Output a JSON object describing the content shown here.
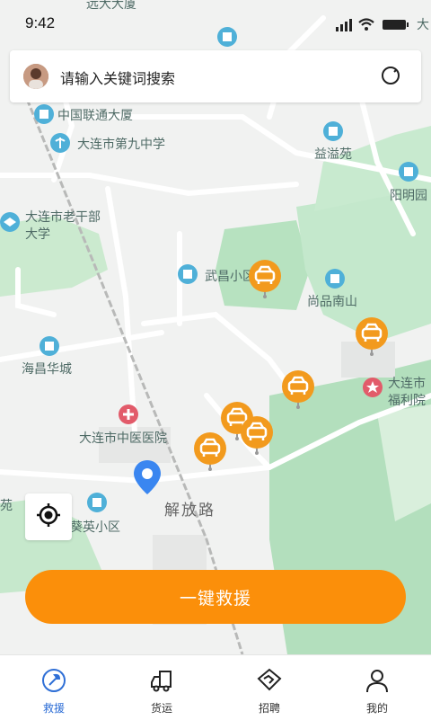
{
  "status_bar": {
    "time": "9:42"
  },
  "search": {
    "placeholder": "请输入关键词搜索"
  },
  "map": {
    "labels": {
      "top_partial": "远大大厦",
      "top_right_partial": "大",
      "unicom": "中国联通大厦",
      "school": "大连市第九中学",
      "yiyiyuan": "益溢苑",
      "yangmingyuan": "阳明园",
      "cadre_univ_line1": "大连市老干部",
      "cadre_univ_line2": "大学",
      "wuchang": "武昌小区",
      "shangpin": "尚品南山",
      "haichang": "海昌华城",
      "welfare_line1": "大连市",
      "welfare_line2": "福利院",
      "tcm_hospital": "大连市中医医院",
      "road": "解放路",
      "kuiying": "葵英小区",
      "left_edge": "苑"
    }
  },
  "actions": {
    "rescue_label": "一键救援"
  },
  "tabs": [
    {
      "label": "救援",
      "icon": "wrench-icon",
      "active": true
    },
    {
      "label": "货运",
      "icon": "truck-icon",
      "active": false
    },
    {
      "label": "招聘",
      "icon": "handshake-icon",
      "active": false
    },
    {
      "label": "我的",
      "icon": "user-icon",
      "active": false
    }
  ],
  "colors": {
    "accent": "#fb8f0a",
    "active_tab": "#2f6fd6",
    "park": "#a9dcb4",
    "poi": "#4fb0d8"
  }
}
